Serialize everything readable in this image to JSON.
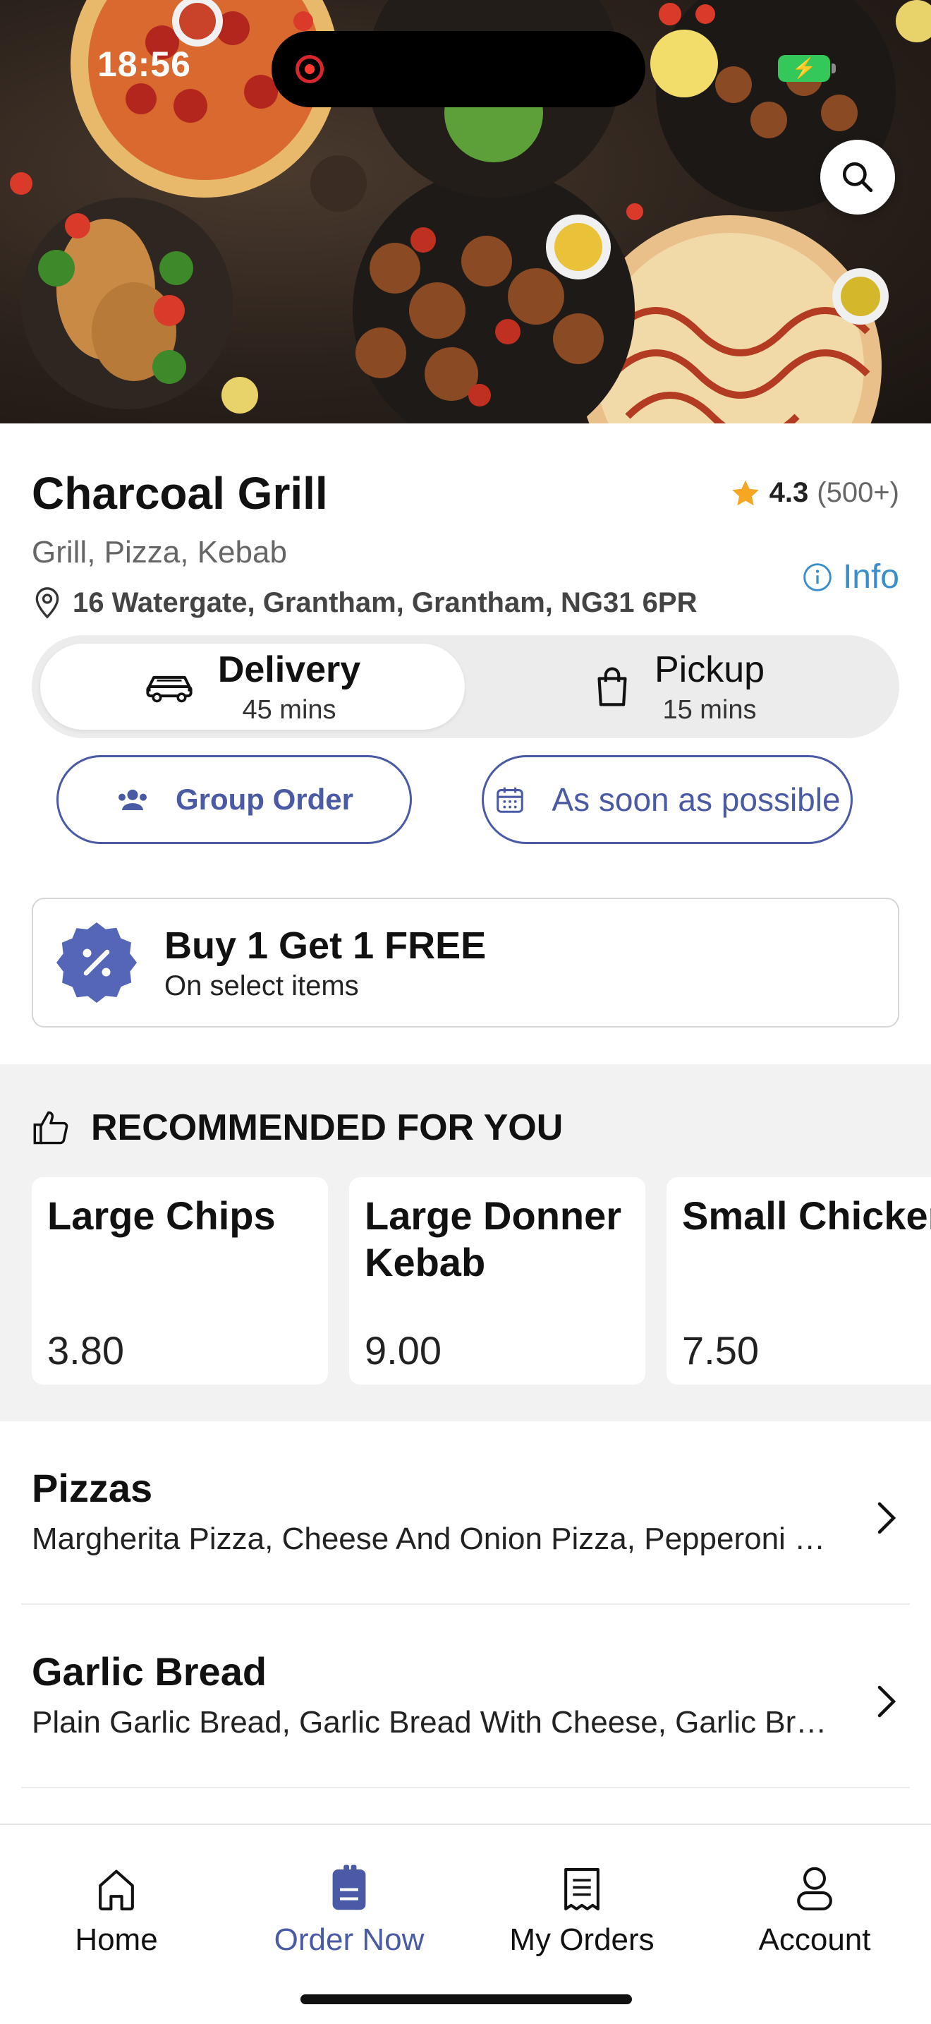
{
  "status_bar": {
    "time": "18:56",
    "battery_icon": "battery-charging-icon",
    "recording_icon": "screen-recording-icon"
  },
  "hero": {
    "image": "food-spread-photo",
    "search_icon": "search-icon"
  },
  "restaurant": {
    "name": "Charcoal Grill",
    "rating": "4.3",
    "rating_count": "(500+)",
    "cuisines": "Grill, Pizza, Kebab",
    "info_label": "Info",
    "address": "16 Watergate, Grantham, Grantham, NG31 6PR"
  },
  "fulfilment": {
    "selected": "Delivery",
    "delivery": {
      "label": "Delivery",
      "time": "45 mins",
      "icon": "car-icon"
    },
    "pickup": {
      "label": "Pickup",
      "time": "15 mins",
      "icon": "shopping-bag-icon"
    }
  },
  "actions": {
    "group_order_label": "Group Order",
    "schedule_label": "As soon as possible"
  },
  "promo": {
    "title": "Buy 1 Get 1 FREE",
    "subtitle": "On select items",
    "icon": "discount-badge-icon"
  },
  "recommended": {
    "heading": "RECOMMENDED FOR YOU",
    "items": [
      {
        "name": "Large Chips",
        "price": "3.80"
      },
      {
        "name": "Large Donner Kebab",
        "price": "9.00"
      },
      {
        "name": "Small Chicken Shish Kebab",
        "price": "7.50"
      }
    ]
  },
  "categories": [
    {
      "title": "Pizzas",
      "items": "Margherita Pizza, Cheese And Onion Pizza, Pepperoni Pizza"
    },
    {
      "title": "Garlic Bread",
      "items": "Plain Garlic Bread, Garlic Bread With Cheese, Garlic Bread With Tomato"
    }
  ],
  "bottom_nav": {
    "active": "Order Now",
    "items": [
      {
        "label": "Home",
        "icon": "home-icon"
      },
      {
        "label": "Order Now",
        "icon": "order-note-icon"
      },
      {
        "label": "My Orders",
        "icon": "receipt-icon"
      },
      {
        "label": "Account",
        "icon": "user-icon"
      }
    ]
  },
  "colors": {
    "accent": "#4a5aa5",
    "link": "#3a8ec9",
    "star": "#f5a623",
    "promo_badge": "#5565b8"
  }
}
